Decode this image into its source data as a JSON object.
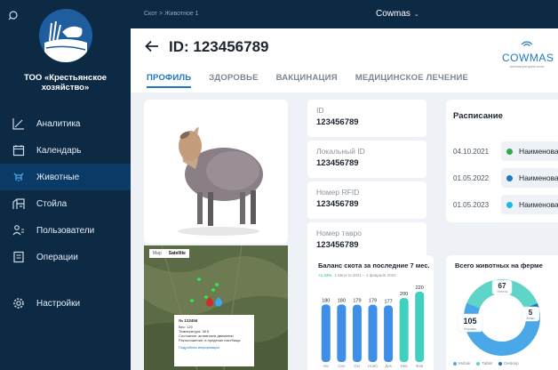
{
  "sidebar": {
    "org_name": "ТОО «Крестьянское хозяйство»",
    "items": [
      {
        "label": "Аналитика",
        "icon": "chart-line-icon",
        "active": false
      },
      {
        "label": "Календарь",
        "icon": "calendar-icon",
        "active": false
      },
      {
        "label": "Животные",
        "icon": "animal-icon",
        "active": true
      },
      {
        "label": "Стойла",
        "icon": "stall-icon",
        "active": false
      },
      {
        "label": "Пользователи",
        "icon": "users-icon",
        "active": false
      },
      {
        "label": "Операции",
        "icon": "operations-icon",
        "active": false
      }
    ],
    "settings": {
      "label": "Настройки",
      "icon": "gear-icon"
    }
  },
  "topbar": {
    "breadcrumb": "Скот > Животное 1",
    "brand": "Cowmas"
  },
  "header": {
    "title": "ID: 123456789",
    "logo_text": "COWMAS",
    "logo_tagline": "система контроля скота",
    "tabs": [
      {
        "label": "ПРОФИЛЬ",
        "active": true
      },
      {
        "label": "ЗДОРОВЬЕ",
        "active": false
      },
      {
        "label": "ВАКЦИНАЦИЯ",
        "active": false
      },
      {
        "label": "МЕДИЦИНСКОЕ ЛЕЧЕНИЕ",
        "active": false
      }
    ]
  },
  "fields": [
    {
      "label": "ID",
      "value": "123456789"
    },
    {
      "label": "Локальный ID",
      "value": "123456789"
    },
    {
      "label": "Номер RFID",
      "value": "123456789"
    },
    {
      "label": "Номер тавро",
      "value": "123456789"
    }
  ],
  "map": {
    "btn_map": "Map",
    "btn_satellite": "Satellite",
    "popup_title": "№ 123456",
    "popup_lines": [
      "Вес: 120",
      "Температура: 38.5",
      "Состояние: активное/в движении",
      "Расположение: в пределах пастбища"
    ],
    "popup_link": "Подробная информация"
  },
  "schedule": {
    "title": "Расписание",
    "rows": [
      {
        "date": "04.10.2021",
        "name": "Наименование",
        "color": "#2eaa4e"
      },
      {
        "date": "01.05.2022",
        "name": "Наименование",
        "color": "#1e78c2"
      },
      {
        "date": "01.05.2023",
        "name": "Наименование",
        "color": "#1bb8e0"
      }
    ]
  },
  "balance": {
    "title": "Баланс скота за последние 7 мес.",
    "change": "+1,43%",
    "period": "1 августа 2021 – 1 февраля 2022"
  },
  "totals": {
    "title": "Всего животных на ферме",
    "segments": [
      {
        "label": "Телята",
        "value": 67,
        "color": "#5fd4c8"
      },
      {
        "label": "Быки",
        "value": 5,
        "color": "#1e6fc0"
      },
      {
        "label": "Коровы",
        "value": 105,
        "color": "#4aa8e8"
      }
    ],
    "legend": [
      {
        "label": "Mobile",
        "color": "#4aa8e8"
      },
      {
        "label": "Tablet",
        "color": "#5fd4c8"
      },
      {
        "label": "Desktop",
        "color": "#1e6fc0"
      }
    ]
  },
  "chart_data": [
    {
      "type": "bar",
      "title": "Баланс скота за последние 7 мес.",
      "categories": [
        "Авг",
        "Сен",
        "Окт",
        "Нояб",
        "Дек",
        "Янв",
        "Фев"
      ],
      "values": [
        180,
        180,
        179,
        179,
        177,
        200,
        220
      ],
      "highlight_color": "#3fd0c0",
      "base_color": "#3f8fe8",
      "ylim": [
        0,
        240
      ]
    },
    {
      "type": "pie",
      "title": "Всего животных на ферме",
      "categories": [
        "Телята",
        "Быки",
        "Коровы"
      ],
      "values": [
        67,
        5,
        105
      ]
    }
  ]
}
